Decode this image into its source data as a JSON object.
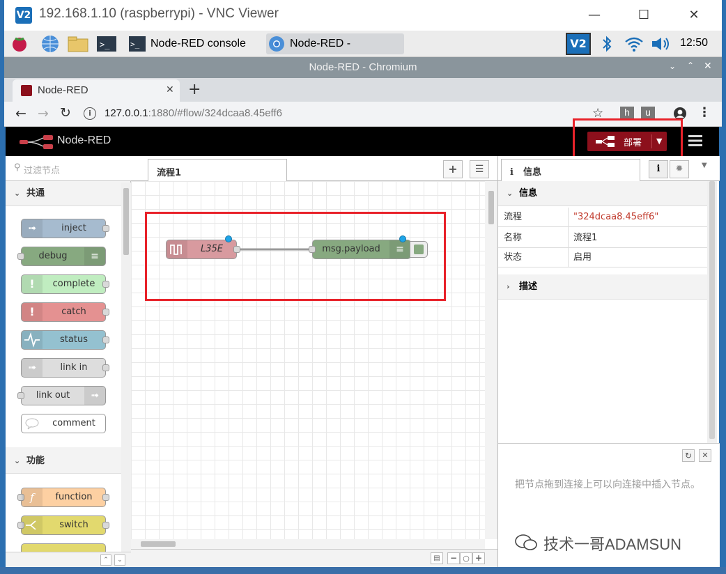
{
  "vnc": {
    "icon_text": "V2",
    "title": "192.168.1.10 (raspberrypi) - VNC Viewer"
  },
  "taskbar": {
    "tasks": [
      {
        "label": "Node-RED console"
      },
      {
        "label": "Node-RED - Chromium"
      }
    ],
    "vnc_badge": "V2",
    "clock": "12:50"
  },
  "chromium": {
    "window_title": "Node-RED - Chromium",
    "tab_label": "Node-RED",
    "url_host": "127.0.0.1",
    "url_rest": ":1880/#flow/324dcaa8.45eff6",
    "ext1": "h",
    "ext2": "u"
  },
  "header": {
    "brand": "Node-RED",
    "deploy_label": "部署"
  },
  "palette": {
    "filter_placeholder": "过滤节点",
    "categories": [
      {
        "label": "共通",
        "nodes": [
          "inject",
          "debug",
          "complete",
          "catch",
          "status",
          "link in",
          "link out",
          "comment"
        ]
      },
      {
        "label": "功能",
        "nodes": [
          "function",
          "switch"
        ]
      }
    ]
  },
  "workspace": {
    "tab_label": "流程1",
    "nodes": [
      {
        "label": "L35E"
      },
      {
        "label": "msg.payload"
      }
    ]
  },
  "sidebar": {
    "tab_label": "信息",
    "section_info": "信息",
    "rows": [
      {
        "key": "流程",
        "value": "\"324dcaa8.45eff6\""
      },
      {
        "key": "名称",
        "value": "流程1"
      },
      {
        "key": "状态",
        "value": "启用"
      }
    ],
    "section_desc": "描述",
    "tip": "把节点拖到连接上可以向连接中插入节点。"
  },
  "watermark": "技术一哥ADAMSUN",
  "colors": {
    "deploy": "#8c101c",
    "highlight": "#e8222a"
  }
}
